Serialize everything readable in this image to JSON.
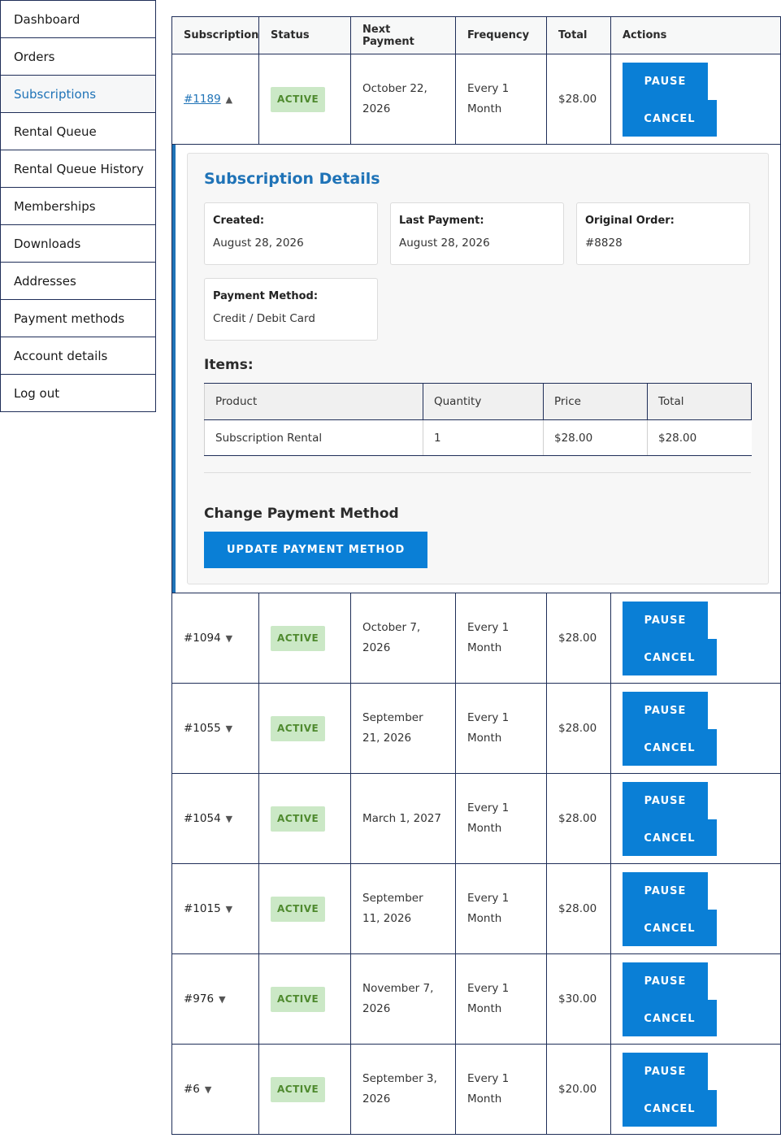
{
  "sidebar": {
    "items": [
      {
        "label": "Dashboard"
      },
      {
        "label": "Orders"
      },
      {
        "label": "Subscriptions",
        "active": true
      },
      {
        "label": "Rental Queue"
      },
      {
        "label": "Rental Queue History"
      },
      {
        "label": "Memberships"
      },
      {
        "label": "Downloads"
      },
      {
        "label": "Addresses"
      },
      {
        "label": "Payment methods"
      },
      {
        "label": "Account details"
      },
      {
        "label": "Log out"
      }
    ]
  },
  "table": {
    "headers": {
      "subscription": "Subscription",
      "status": "Status",
      "next_payment": "Next Payment",
      "frequency": "Frequency",
      "total": "Total",
      "actions": "Actions"
    },
    "pause_label": "PAUSE",
    "cancel_label": "CANCEL",
    "rows": [
      {
        "id": "#1189",
        "toggle": "▲",
        "status": "ACTIVE",
        "next_payment": "October 22, 2026",
        "frequency": "Every 1 Month",
        "total": "$28.00"
      },
      {
        "id": "#1094",
        "toggle": "▼",
        "status": "ACTIVE",
        "next_payment": "October 7, 2026",
        "frequency": "Every 1 Month",
        "total": "$28.00"
      },
      {
        "id": "#1055",
        "toggle": "▼",
        "status": "ACTIVE",
        "next_payment": "September 21, 2026",
        "frequency": "Every 1 Month",
        "total": "$28.00"
      },
      {
        "id": "#1054",
        "toggle": "▼",
        "status": "ACTIVE",
        "next_payment": "March 1, 2027",
        "frequency": "Every 1 Month",
        "total": "$28.00"
      },
      {
        "id": "#1015",
        "toggle": "▼",
        "status": "ACTIVE",
        "next_payment": "September 11, 2026",
        "frequency": "Every 1 Month",
        "total": "$28.00"
      },
      {
        "id": "#976",
        "toggle": "▼",
        "status": "ACTIVE",
        "next_payment": "November 7, 2026",
        "frequency": "Every 1 Month",
        "total": "$30.00"
      },
      {
        "id": "#6",
        "toggle": "▼",
        "status": "ACTIVE",
        "next_payment": "September 3, 2026",
        "frequency": "Every 1 Month",
        "total": "$20.00"
      }
    ]
  },
  "details": {
    "title": "Subscription Details",
    "created_label": "Created:",
    "created_value": "August 28, 2026",
    "last_payment_label": "Last Payment:",
    "last_payment_value": "August 28, 2026",
    "original_order_label": "Original Order:",
    "original_order_value": "#8828",
    "payment_method_label": "Payment Method:",
    "payment_method_value": "Credit / Debit Card",
    "items_title": "Items:",
    "items_headers": {
      "product": "Product",
      "quantity": "Quantity",
      "price": "Price",
      "total": "Total"
    },
    "items": [
      {
        "product": "Subscription Rental",
        "quantity": "1",
        "price": "$28.00",
        "total": "$28.00"
      }
    ],
    "change_payment_title": "Change Payment Method",
    "update_button": "UPDATE PAYMENT METHOD"
  },
  "colors": {
    "accent": "#1f73b7",
    "button": "#0a7fd6",
    "badge_bg": "#cbe8c6",
    "badge_text": "#4f8a2f",
    "border": "#1f2e58"
  }
}
